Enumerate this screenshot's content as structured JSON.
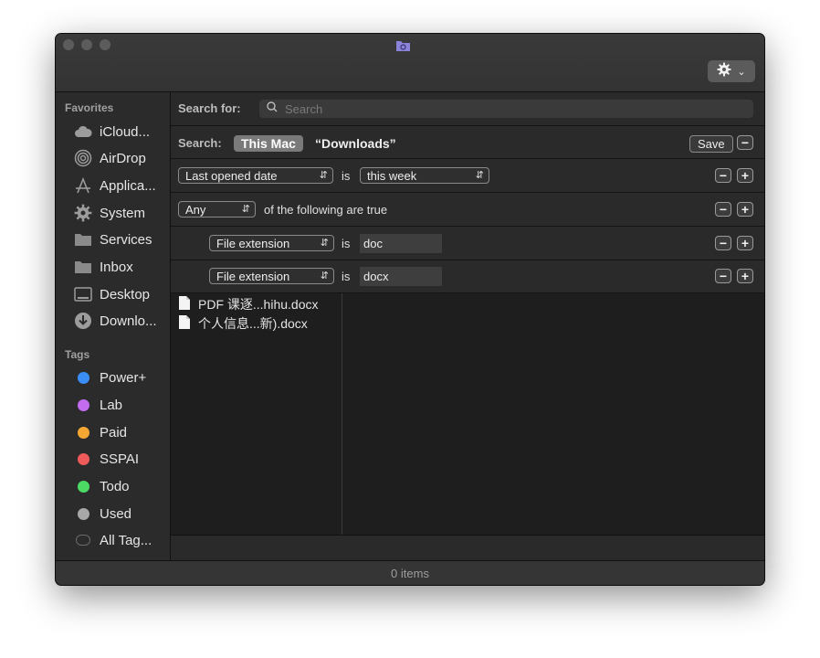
{
  "window": {
    "status": "0 items"
  },
  "toolbar": {
    "action_icon": "gear-icon"
  },
  "sidebar": {
    "favorites_header": "Favorites",
    "favorites": [
      {
        "label": "iCloud...",
        "icon": "cloud-icon"
      },
      {
        "label": "AirDrop",
        "icon": "airdrop-icon"
      },
      {
        "label": "Applica...",
        "icon": "applications-icon"
      },
      {
        "label": "System",
        "icon": "gear-icon"
      },
      {
        "label": "Services",
        "icon": "folder-icon"
      },
      {
        "label": "Inbox",
        "icon": "folder-icon"
      },
      {
        "label": "Desktop",
        "icon": "desktop-icon"
      },
      {
        "label": "Downlo...",
        "icon": "download-icon"
      }
    ],
    "tags_header": "Tags",
    "tags": [
      {
        "label": "Power+",
        "color": "#3b8ef5"
      },
      {
        "label": "Lab",
        "color": "#c46cf0"
      },
      {
        "label": "Paid",
        "color": "#f5a733"
      },
      {
        "label": "SSPAI",
        "color": "#f05a5a"
      },
      {
        "label": "Todo",
        "color": "#4cd964"
      },
      {
        "label": "Used",
        "color": "#a8a8a8"
      },
      {
        "label": "All Tag...",
        "color": "#555555"
      }
    ]
  },
  "search": {
    "label": "Search for:",
    "placeholder": "Search",
    "scope_label": "Search:",
    "scope_active": "This Mac",
    "scope_other": "“Downloads”",
    "save_label": "Save"
  },
  "criteria": {
    "row1": {
      "attribute": "Last opened date",
      "operator": "is",
      "value": "this week"
    },
    "row2": {
      "attribute": "Any",
      "text": "of the following are true"
    },
    "row3": {
      "attribute": "File extension",
      "operator": "is",
      "value": "doc"
    },
    "row4": {
      "attribute": "File extension",
      "operator": "is",
      "value": "docx"
    },
    "minus": "−",
    "plus": "+"
  },
  "results": [
    {
      "name": "PDF 课逐...hihu.docx"
    },
    {
      "name": "个人信息...新).docx"
    }
  ]
}
